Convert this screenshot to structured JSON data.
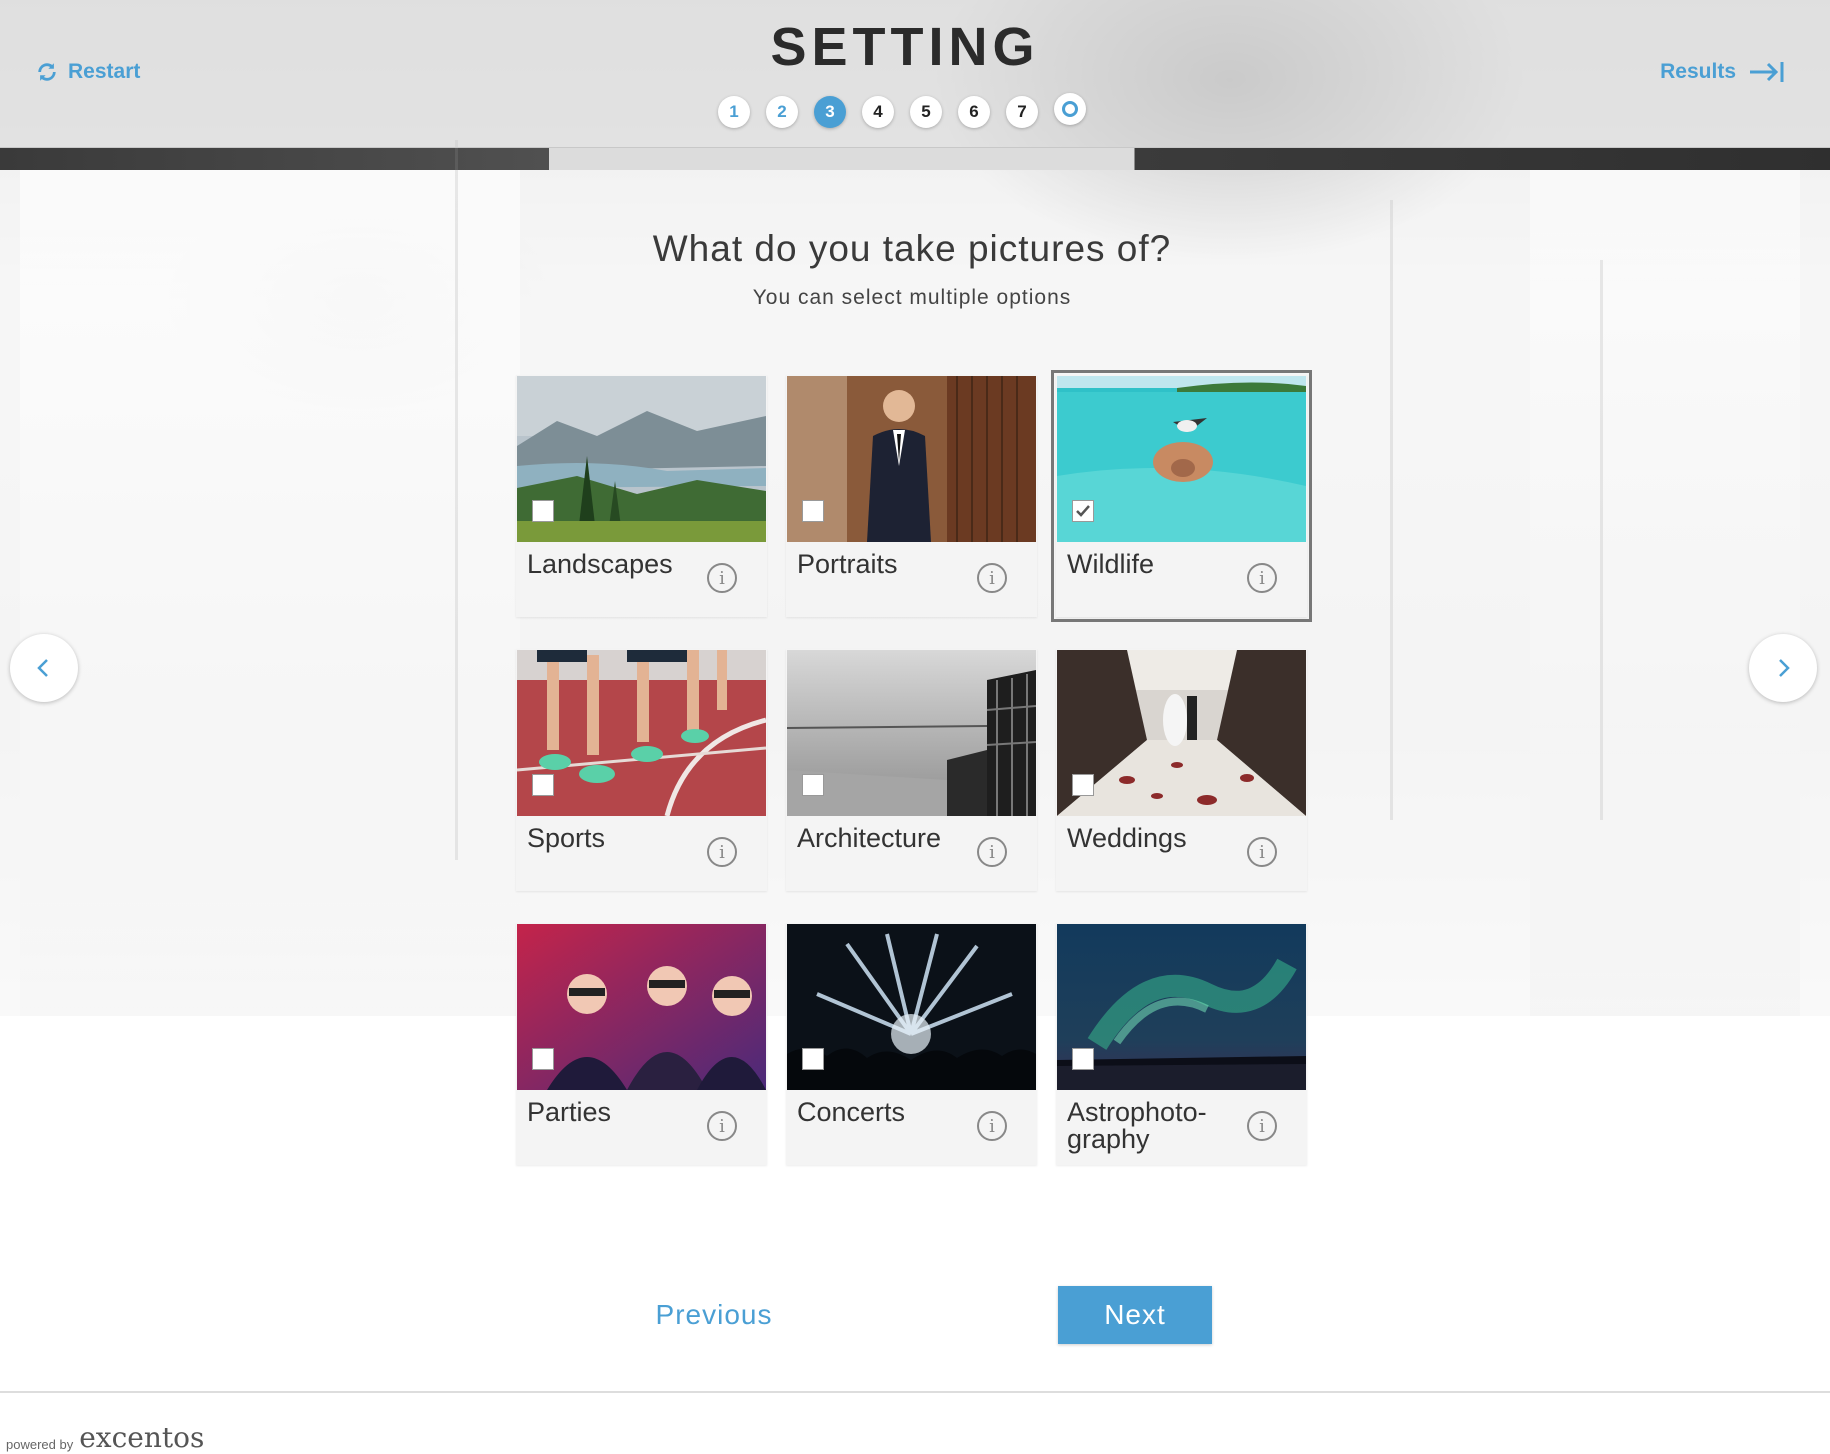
{
  "header": {
    "title": "SETTING",
    "restart_label": "Restart",
    "results_label": "Results",
    "steps": [
      "1",
      "2",
      "3",
      "4",
      "5",
      "6",
      "7"
    ],
    "current_step": "3"
  },
  "question": {
    "title": "What do you take pictures of?",
    "hint": "You can select multiple options"
  },
  "options": [
    {
      "label": "Landscapes",
      "selected": false,
      "icon": "landscape-photo"
    },
    {
      "label": "Portraits",
      "selected": false,
      "icon": "portrait-photo"
    },
    {
      "label": "Wildlife",
      "selected": true,
      "icon": "wildlife-photo"
    },
    {
      "label": "Sports",
      "selected": false,
      "icon": "sports-photo"
    },
    {
      "label": "Architecture",
      "selected": false,
      "icon": "architecture-photo"
    },
    {
      "label": "Weddings",
      "selected": false,
      "icon": "weddings-photo"
    },
    {
      "label": "Parties",
      "selected": false,
      "icon": "parties-photo"
    },
    {
      "label": "Concerts",
      "selected": false,
      "icon": "concerts-photo"
    },
    {
      "label": "Astrophoto-\ngraphy",
      "selected": false,
      "icon": "astrophotography-photo"
    }
  ],
  "navigation": {
    "previous_label": "Previous",
    "next_label": "Next"
  },
  "footer": {
    "powered_by": "powered by",
    "brand": "excentos"
  },
  "colors": {
    "accent": "#4a9fd4",
    "title": "#2b2b2b"
  }
}
